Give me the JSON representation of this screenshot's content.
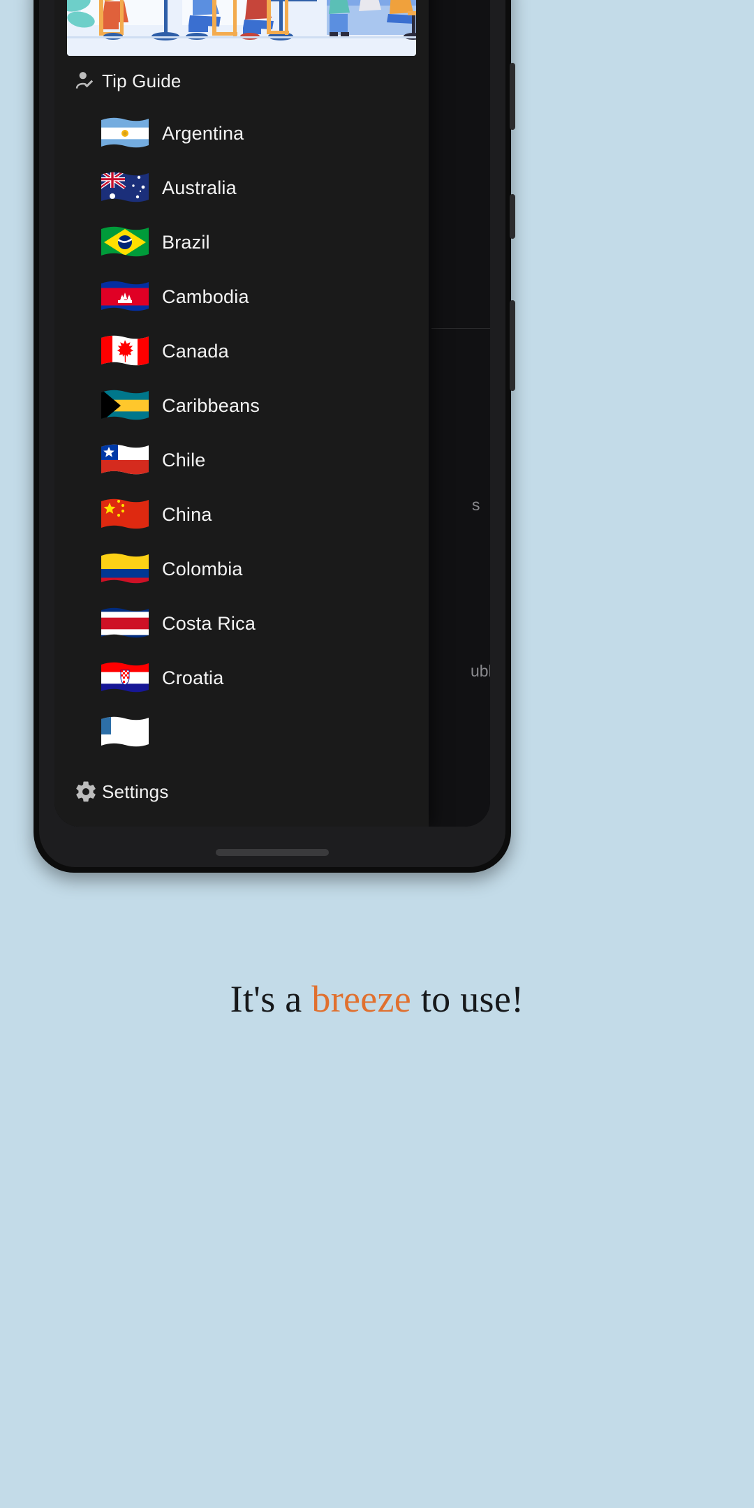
{
  "page": {
    "background_color": "#c3dbe8",
    "caption_prefix": "It's a ",
    "caption_accent": "breeze",
    "caption_suffix": " to use!",
    "accent_color": "#e0702f"
  },
  "drawer": {
    "background_color": "#1a1a1a",
    "header_illustration": "people-dining-cafe-illustration",
    "tip_guide": {
      "label": "Tip Guide",
      "icon": "person-check-icon"
    },
    "countries": [
      {
        "name": "Argentina",
        "flag": "flag-argentina"
      },
      {
        "name": "Australia",
        "flag": "flag-australia"
      },
      {
        "name": "Brazil",
        "flag": "flag-brazil"
      },
      {
        "name": "Cambodia",
        "flag": "flag-cambodia"
      },
      {
        "name": "Canada",
        "flag": "flag-canada"
      },
      {
        "name": "Caribbeans",
        "flag": "flag-bahamas"
      },
      {
        "name": "Chile",
        "flag": "flag-chile"
      },
      {
        "name": "China",
        "flag": "flag-china"
      },
      {
        "name": "Colombia",
        "flag": "flag-colombia"
      },
      {
        "name": "Costa Rica",
        "flag": "flag-costa-rica"
      },
      {
        "name": "Croatia",
        "flag": "flag-croatia"
      },
      {
        "name": "",
        "flag": "flag-partial-cut-off"
      }
    ],
    "settings": {
      "label": "Settings",
      "icon": "gear-icon"
    }
  },
  "background_app": {
    "fragment_one": "s",
    "fragment_two": "ublic"
  }
}
